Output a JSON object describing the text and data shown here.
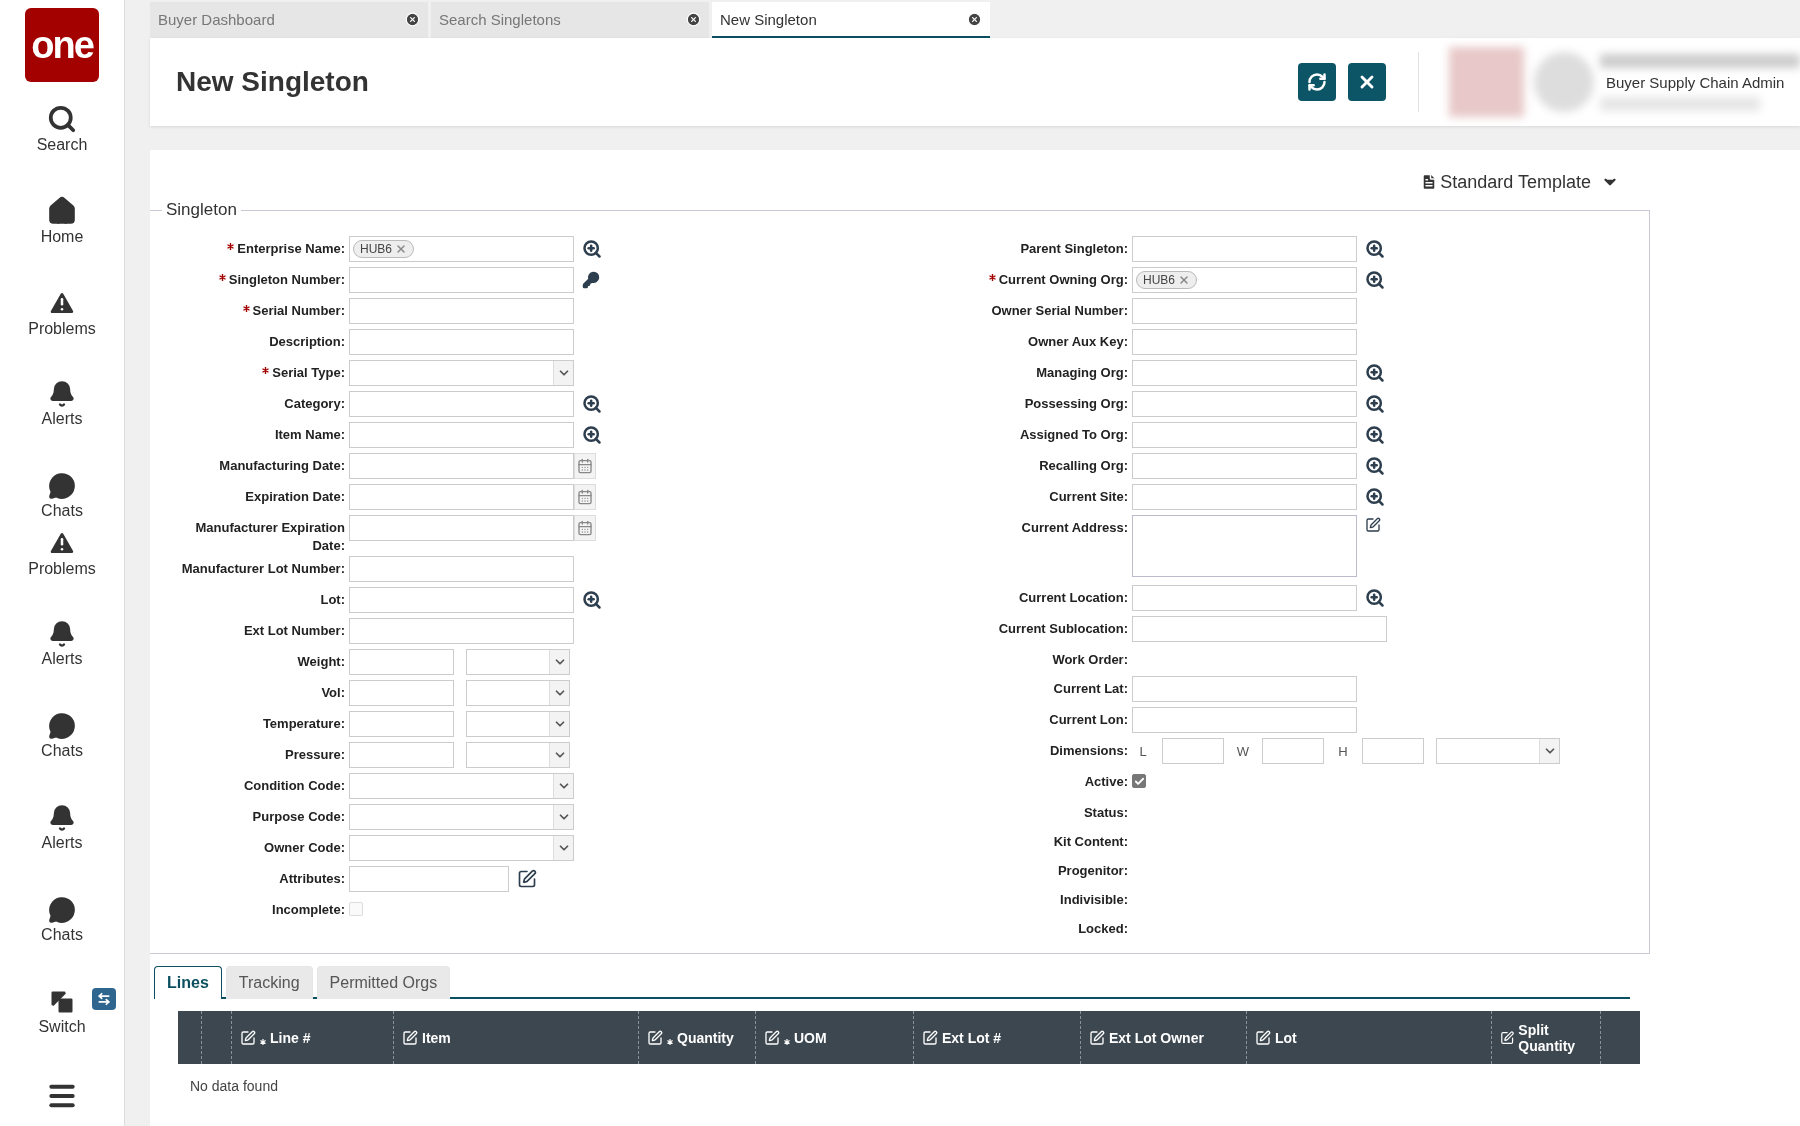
{
  "sidebar": {
    "logo": "one",
    "items": [
      {
        "kind": "search",
        "label": "Search"
      },
      {
        "kind": "home",
        "label": "Home"
      },
      {
        "kind": "problems",
        "label": "Problems"
      },
      {
        "kind": "alerts",
        "label": "Alerts"
      },
      {
        "kind": "chats",
        "label": "Chats"
      },
      {
        "kind": "problems",
        "label": "Problems"
      },
      {
        "kind": "alerts",
        "label": "Alerts"
      },
      {
        "kind": "chats",
        "label": "Chats"
      },
      {
        "kind": "alerts",
        "label": "Alerts"
      },
      {
        "kind": "chats",
        "label": "Chats"
      },
      {
        "kind": "switch",
        "label": "Switch"
      }
    ]
  },
  "tabs": [
    {
      "label": "Buyer Dashboard",
      "selected": false
    },
    {
      "label": "Search Singletons",
      "selected": false
    },
    {
      "label": "New Singleton",
      "selected": true
    }
  ],
  "header": {
    "title": "New Singleton",
    "user_role": "Buyer Supply Chain Admin"
  },
  "template": "Standard Template",
  "section": "Singleton",
  "left_fields": [
    {
      "label": "Enterprise Name:",
      "required": true,
      "kind": "tag",
      "value": "HUB6"
    },
    {
      "label": "Singleton Number:",
      "required": true,
      "kind": "key"
    },
    {
      "label": "Serial Number:",
      "required": true,
      "kind": "text"
    },
    {
      "label": "Description:",
      "required": false,
      "kind": "text"
    },
    {
      "label": "Serial Type:",
      "required": true,
      "kind": "select"
    },
    {
      "label": "Category:",
      "required": false,
      "kind": "lookup"
    },
    {
      "label": "Item Name:",
      "required": false,
      "kind": "lookup"
    },
    {
      "label": "Manufacturing Date:",
      "required": false,
      "kind": "date"
    },
    {
      "label": "Expiration Date:",
      "required": false,
      "kind": "date"
    },
    {
      "label": "Manufacturer Expiration Date:",
      "required": false,
      "kind": "date"
    },
    {
      "label": "Manufacturer Lot Number:",
      "required": false,
      "kind": "text"
    },
    {
      "label": "Lot:",
      "required": false,
      "kind": "lookup"
    },
    {
      "label": "Ext Lot Number:",
      "required": false,
      "kind": "text"
    },
    {
      "label": "Weight:",
      "required": false,
      "kind": "measure"
    },
    {
      "label": "Vol:",
      "required": false,
      "kind": "measure"
    },
    {
      "label": "Temperature:",
      "required": false,
      "kind": "measure"
    },
    {
      "label": "Pressure:",
      "required": false,
      "kind": "measure"
    },
    {
      "label": "Condition Code:",
      "required": false,
      "kind": "select"
    },
    {
      "label": "Purpose Code:",
      "required": false,
      "kind": "select"
    },
    {
      "label": "Owner Code:",
      "required": false,
      "kind": "select"
    },
    {
      "label": "Attributes:",
      "required": false,
      "kind": "attributes"
    },
    {
      "label": "Incomplete:",
      "required": false,
      "kind": "checkbox",
      "checked": false
    }
  ],
  "right_fields": [
    {
      "label": "Parent Singleton:",
      "required": false,
      "kind": "lookup"
    },
    {
      "label": "Current Owning Org:",
      "required": true,
      "kind": "tag",
      "value": "HUB6"
    },
    {
      "label": "Owner Serial Number:",
      "required": false,
      "kind": "text"
    },
    {
      "label": "Owner Aux Key:",
      "required": false,
      "kind": "text"
    },
    {
      "label": "Managing Org:",
      "required": false,
      "kind": "lookup"
    },
    {
      "label": "Possessing Org:",
      "required": false,
      "kind": "lookup"
    },
    {
      "label": "Assigned To Org:",
      "required": false,
      "kind": "lookup"
    },
    {
      "label": "Recalling Org:",
      "required": false,
      "kind": "lookup"
    },
    {
      "label": "Current Site:",
      "required": false,
      "kind": "lookup"
    },
    {
      "label": "Current Address:",
      "required": false,
      "kind": "textarea"
    },
    {
      "label": "Current Location:",
      "required": false,
      "kind": "lookup"
    },
    {
      "label": "Current Sublocation:",
      "required": false,
      "kind": "wide"
    },
    {
      "label": "Work Order:",
      "required": false,
      "kind": "readonly"
    },
    {
      "label": "Current Lat:",
      "required": false,
      "kind": "text"
    },
    {
      "label": "Current Lon:",
      "required": false,
      "kind": "text"
    },
    {
      "label": "Dimensions:",
      "required": false,
      "kind": "dimensions",
      "parts": [
        "L",
        "W",
        "H"
      ]
    },
    {
      "label": "Active:",
      "required": false,
      "kind": "checkbox",
      "checked": true
    },
    {
      "label": "Status:",
      "required": false,
      "kind": "readonly"
    },
    {
      "label": "Kit Content:",
      "required": false,
      "kind": "readonly"
    },
    {
      "label": "Progenitor:",
      "required": false,
      "kind": "readonly"
    },
    {
      "label": "Indivisible:",
      "required": false,
      "kind": "readonly"
    },
    {
      "label": "Locked:",
      "required": false,
      "kind": "readonly"
    }
  ],
  "bottom_tabs": [
    {
      "label": "Lines",
      "selected": true
    },
    {
      "label": "Tracking",
      "selected": false
    },
    {
      "label": "Permitted Orgs",
      "selected": false
    }
  ],
  "table": {
    "columns": [
      {
        "label": "Line #",
        "required": true
      },
      {
        "label": "Item",
        "required": false
      },
      {
        "label": "Quantity",
        "required": true
      },
      {
        "label": "UOM",
        "required": true
      },
      {
        "label": "Ext Lot #",
        "required": false
      },
      {
        "label": "Ext Lot Owner",
        "required": false
      },
      {
        "label": "Lot",
        "required": false
      },
      {
        "label": "Split Quantity",
        "required": false
      }
    ],
    "empty_text": "No data found"
  }
}
